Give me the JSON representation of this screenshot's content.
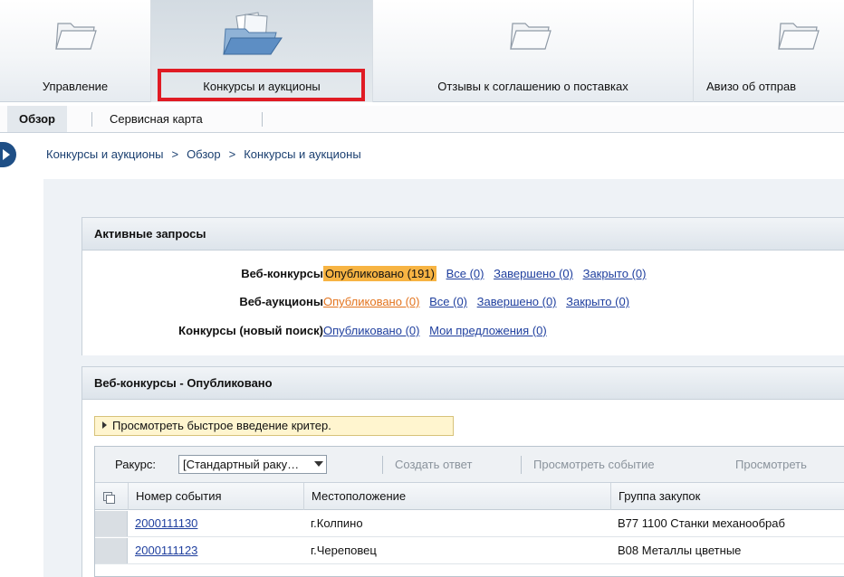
{
  "topnav": {
    "items": [
      {
        "label": "Управление"
      },
      {
        "label": "Конкурсы и аукционы"
      },
      {
        "label": "Отзывы к соглашению о поставках"
      },
      {
        "label": "Авизо об отправ"
      }
    ]
  },
  "subtabs": [
    {
      "label": "Обзор"
    },
    {
      "label": "Сервисная карта"
    }
  ],
  "breadcrumb": [
    "Конкурсы и аукционы",
    "Обзор",
    "Конкурсы и аукционы"
  ],
  "breadcrumb_separator": ">",
  "active_requests": {
    "title": "Активные запросы",
    "rows": [
      {
        "label": "Веб-конкурсы",
        "links": [
          "Опубликовано (191)",
          "Все (0)",
          "Завершено (0)",
          "Закрыто (0)"
        ]
      },
      {
        "label": "Веб-аукционы",
        "links": [
          "Опубликовано (0)",
          "Все (0)",
          "Завершено (0)",
          "Закрыто (0)"
        ]
      },
      {
        "label": "Конкурсы (новый поиск)",
        "links": [
          "Опубликовано (0)",
          "Мои предложения (0)"
        ]
      }
    ]
  },
  "published_panel": {
    "title": "Веб-конкурсы - Опубликовано",
    "quickview_label": "Просмотреть быстрое введение критер.",
    "toolbar": {
      "view_label": "Ракурс:",
      "view_value": "[Стандартный раку…",
      "create_response": "Создать ответ",
      "view_event": "Просмотреть событие",
      "view_more": "Просмотреть"
    },
    "columns": [
      "Номер события",
      "Местоположение",
      "Группа закупок"
    ],
    "rows": [
      {
        "event_number": "2000111130",
        "location": "г.Колпино",
        "group": "B77 1100 Станки механообраб"
      },
      {
        "event_number": "2000111123",
        "location": "г.Череповец",
        "group": "B08 Металлы цветные"
      }
    ]
  },
  "colors": {
    "highlight": "#f7b443",
    "link": "#1f3f9e",
    "orange_link": "#e3741e",
    "red_frame": "#e01b24"
  }
}
